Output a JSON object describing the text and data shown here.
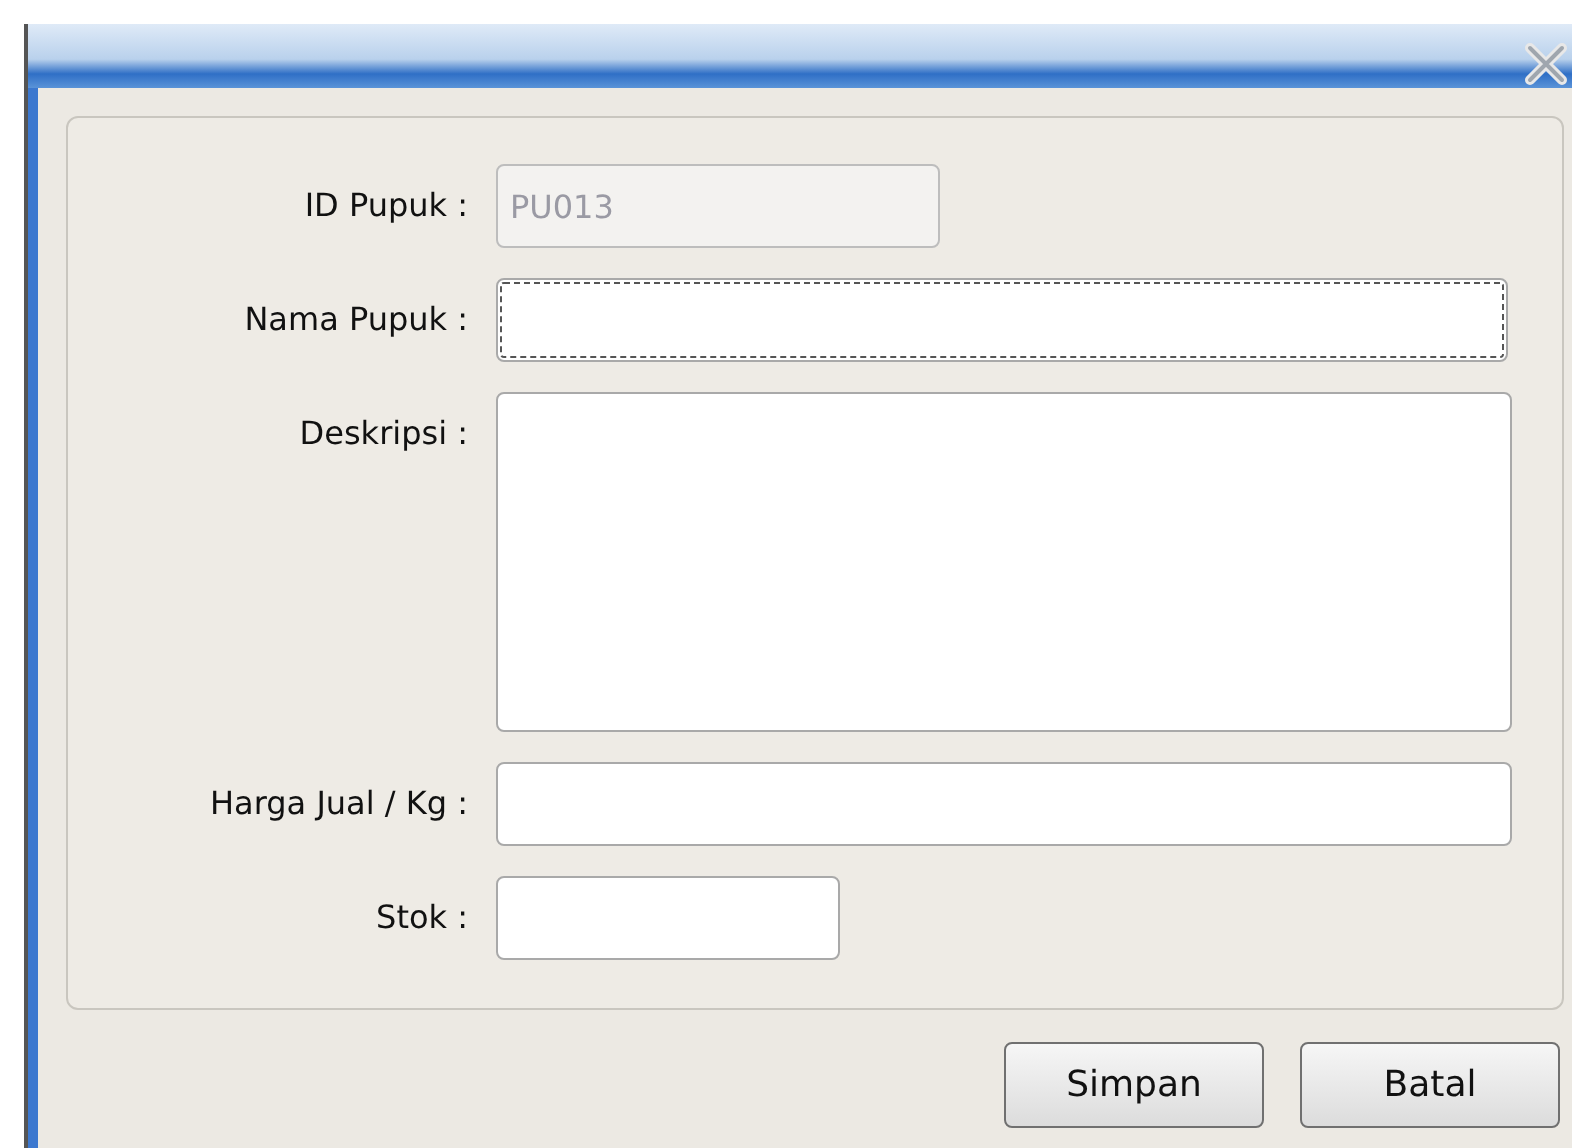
{
  "fields": [
    {
      "label": "ID Pupuk :",
      "kind": "text",
      "value": "PU013",
      "disabled": true,
      "focused": false
    },
    {
      "label": "Nama Pupuk :",
      "kind": "text",
      "disabled": false,
      "focused": true
    },
    {
      "label": "Deskripsi :",
      "kind": "textarea",
      "disabled": false,
      "focused": false
    },
    {
      "label": "Harga Jual / Kg :",
      "kind": "text",
      "disabled": false,
      "focused": false
    },
    {
      "label": "Stok :",
      "kind": "text",
      "disabled": false,
      "focused": false
    }
  ],
  "buttons": [
    "Simpan",
    "Batal"
  ]
}
